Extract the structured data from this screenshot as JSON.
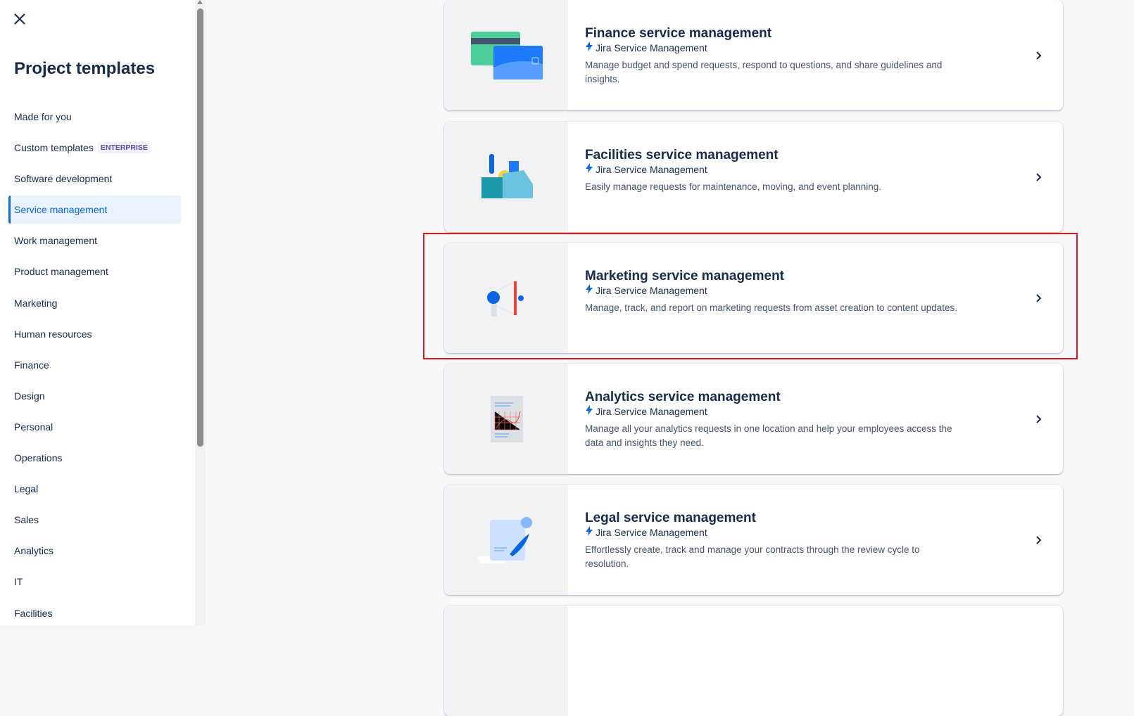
{
  "sidebar": {
    "title": "Project templates",
    "items": [
      {
        "label": "Made for you"
      },
      {
        "label": "Custom templates",
        "badge": "ENTERPRISE"
      },
      {
        "label": "Software development"
      },
      {
        "label": "Service management",
        "selected": true
      },
      {
        "label": "Work management"
      },
      {
        "label": "Product management"
      },
      {
        "label": "Marketing"
      },
      {
        "label": "Human resources"
      },
      {
        "label": "Finance"
      },
      {
        "label": "Design"
      },
      {
        "label": "Personal"
      },
      {
        "label": "Operations"
      },
      {
        "label": "Legal"
      },
      {
        "label": "Sales"
      },
      {
        "label": "Analytics"
      },
      {
        "label": "IT"
      },
      {
        "label": "Facilities"
      }
    ]
  },
  "templates": [
    {
      "title": "Finance service management",
      "product": "Jira Service Management",
      "description": "Manage budget and spend requests, respond to questions, and share guidelines and insights.",
      "icon": "credit-card-illustration"
    },
    {
      "title": "Facilities service management",
      "product": "Jira Service Management",
      "description": "Easily manage requests for maintenance, moving, and event planning.",
      "icon": "toolbox-illustration"
    },
    {
      "title": "Marketing service management",
      "product": "Jira Service Management",
      "description": "Manage, track, and report on marketing requests from asset creation to content updates.",
      "icon": "megaphone-illustration",
      "highlighted": true
    },
    {
      "title": "Analytics service management",
      "product": "Jira Service Management",
      "description": "Manage all your analytics requests in one location and help your employees access the data and insights they need.",
      "icon": "chart-document-illustration"
    },
    {
      "title": "Legal service management",
      "product": "Jira Service Management",
      "description": "Effortlessly create, track and manage your contracts through the review cycle to resolution.",
      "icon": "contract-illustration"
    }
  ],
  "colors": {
    "accent": "#0c66e4",
    "highlight": "#e3161b",
    "selected_bg": "#e9f2ff"
  }
}
